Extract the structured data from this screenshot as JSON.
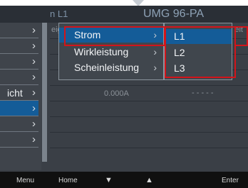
{
  "titlebar": {
    "left": "n L1",
    "right": "UMG 96-PA"
  },
  "background_table": {
    "headers": [
      "eig",
      "eit"
    ],
    "rows": [
      {
        "value": "0.000A",
        "dashes": "- - - - -"
      },
      {
        "value": "0.000A",
        "dashes": "- - - - -"
      }
    ]
  },
  "left_menu": {
    "items": [
      {
        "label": "",
        "chevron": "›"
      },
      {
        "label": "",
        "chevron": "›"
      },
      {
        "label": "",
        "chevron": "›"
      },
      {
        "label": "",
        "chevron": "›"
      },
      {
        "label": "icht",
        "chevron": "›"
      },
      {
        "label": "",
        "chevron": "›",
        "selected": true
      },
      {
        "label": "",
        "chevron": "›"
      },
      {
        "label": "",
        "chevron": "›"
      }
    ]
  },
  "submenu": {
    "items": [
      {
        "label": "Strom",
        "chevron": "›",
        "selected": true
      },
      {
        "label": "Wirkleistung",
        "chevron": "›"
      },
      {
        "label": "Scheinleistung",
        "chevron": "›"
      }
    ]
  },
  "submenu2": {
    "items": [
      {
        "label": "L1",
        "selected": true
      },
      {
        "label": "L2"
      },
      {
        "label": "L3"
      }
    ]
  },
  "bottom_bar": {
    "menu": "Menu",
    "home": "Home",
    "down_icon": "▼",
    "up_icon": "▲",
    "enter": "Enter"
  },
  "colors": {
    "accent": "#145c98",
    "highlight": "#d3141a"
  }
}
